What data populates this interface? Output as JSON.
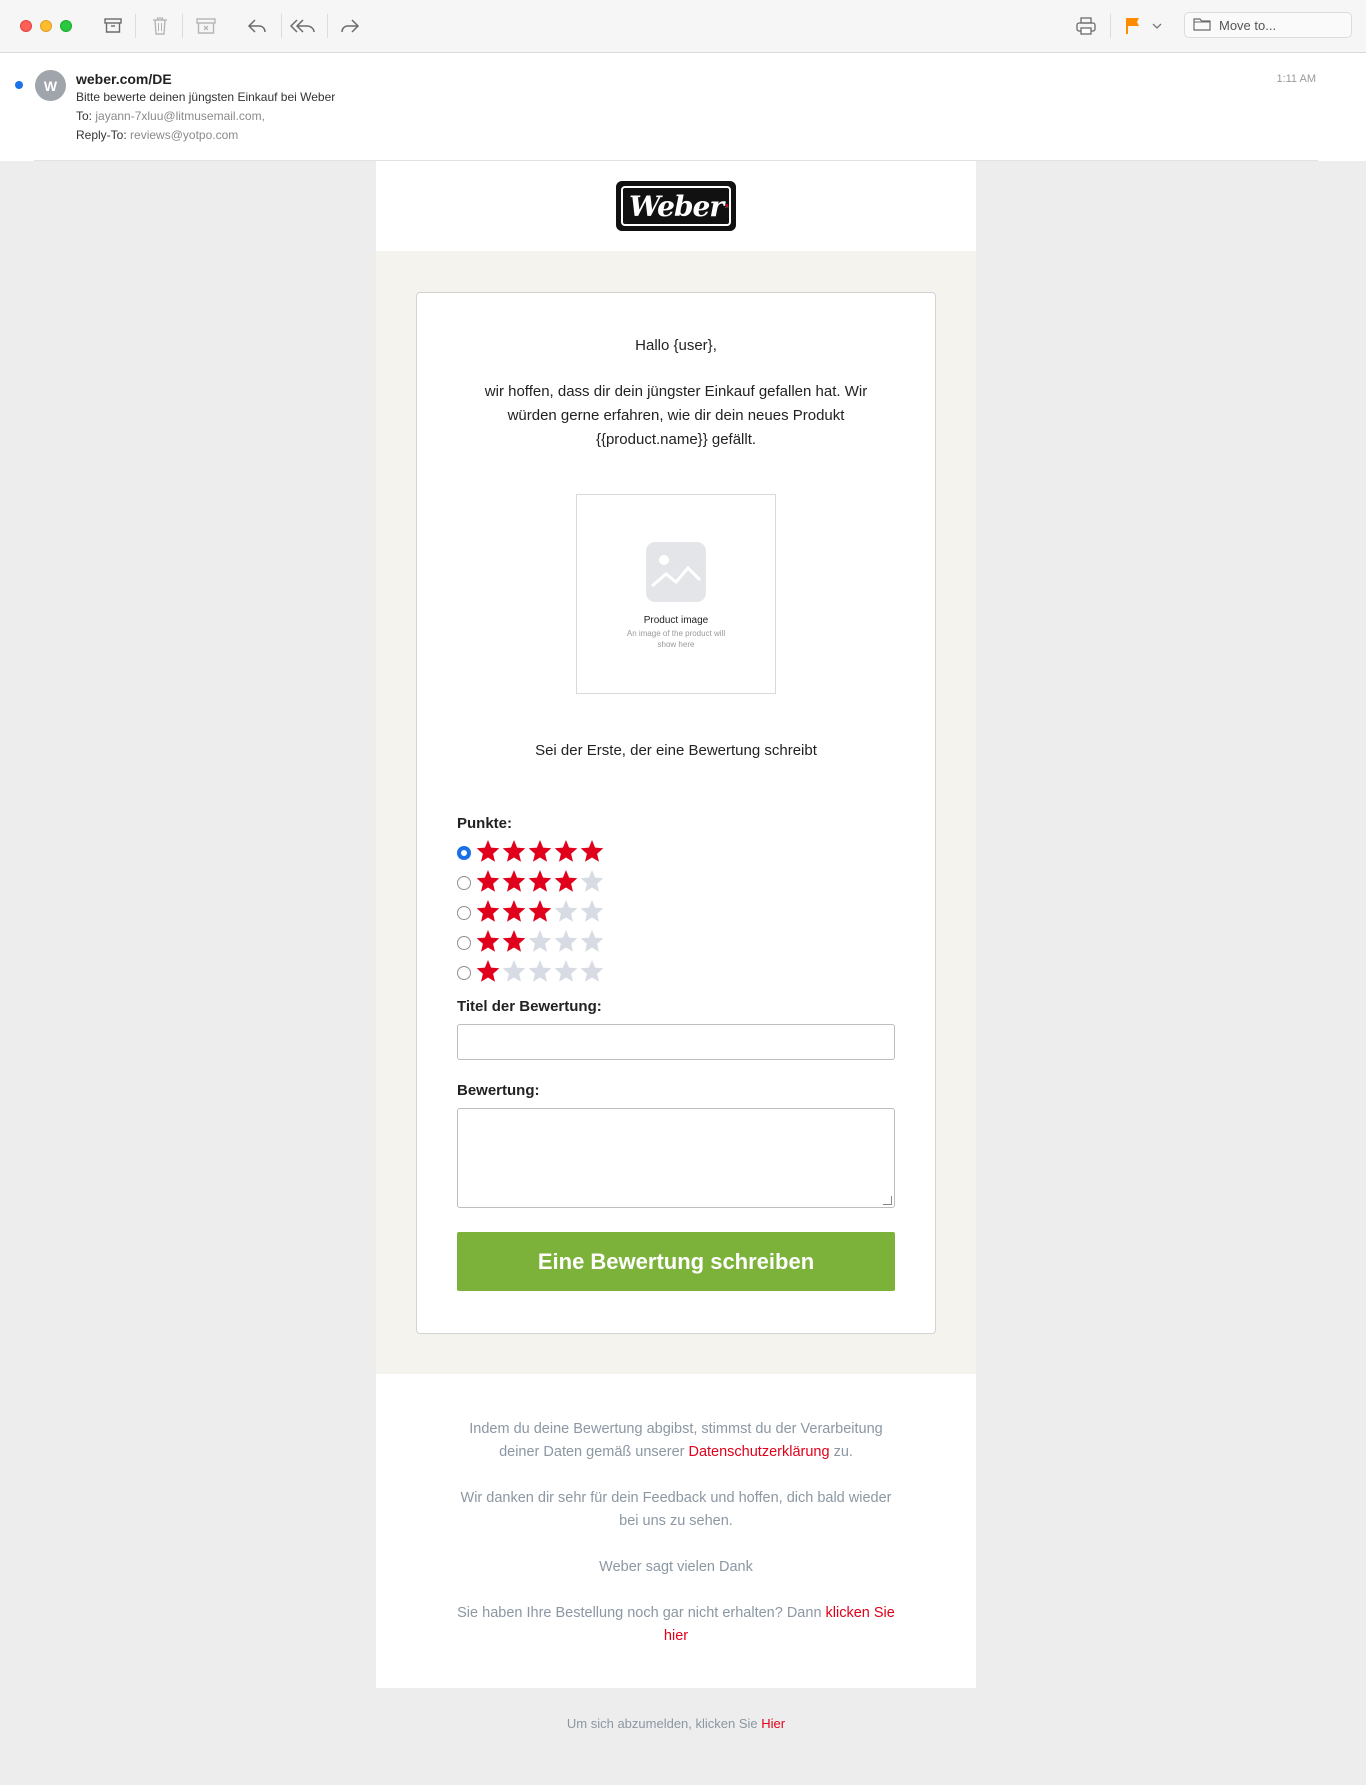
{
  "toolbar": {
    "window_controls": [
      "close",
      "minimize",
      "zoom"
    ],
    "actions": [
      "archive-icon",
      "trash-icon",
      "junk-icon",
      "reply-icon",
      "reply-all-icon",
      "forward-icon",
      "print-icon",
      "flag-icon"
    ],
    "flag_color": "#ff8c00",
    "move_to_label": "Move to..."
  },
  "message": {
    "avatar_initial": "W",
    "from": "weber.com/DE",
    "subject": "Bitte bewerte deinen jüngsten Einkauf bei Weber",
    "to_label": "To:",
    "to_value": "jayann-7xluu@litmusemail.com,",
    "reply_to_label": "Reply-To:",
    "reply_to_value": "reviews@yotpo.com",
    "time": "1:11 AM"
  },
  "email": {
    "logo_text": "Weber",
    "greeting": "Hallo {user},",
    "intro": "wir hoffen, dass dir dein jüngster Einkauf gefallen hat. Wir würden gerne erfahren, wie dir dein neues Produkt {{product.name}} gefällt.",
    "product_image": {
      "title": "Product image",
      "subtitle": "An image of the product will show here"
    },
    "be_first": "Sei der Erste, der eine Bewertung schreibt",
    "points_label": "Punkte:",
    "ratings": [
      5,
      4,
      3,
      2,
      1
    ],
    "selected_rating": 5,
    "title_label": "Titel der Bewertung:",
    "review_label": "Bewertung:",
    "submit_label": "Eine Bewertung schreiben",
    "colors": {
      "star_on": "#e0001b",
      "star_off": "#d7dbe3",
      "button": "#7cb23a",
      "link": "#e0001b"
    }
  },
  "footer": {
    "consent_pre": "Indem du deine Bewertung abgibst, stimmst du der Verarbeitung deiner Daten gemäß unserer ",
    "consent_link": "Datenschutzerklärung",
    "consent_post": " zu.",
    "thanks": "Wir danken dir sehr für dein Feedback und hoffen, dich bald wieder bei uns zu sehen.",
    "signoff": "Weber sagt vielen Dank",
    "not_received_pre": "Sie haben Ihre Bestellung noch gar nicht erhalten? Dann ",
    "not_received_link": "klicken Sie hier",
    "unsubscribe_pre": "Um sich abzumelden, klicken Sie ",
    "unsubscribe_link": "Hier"
  }
}
